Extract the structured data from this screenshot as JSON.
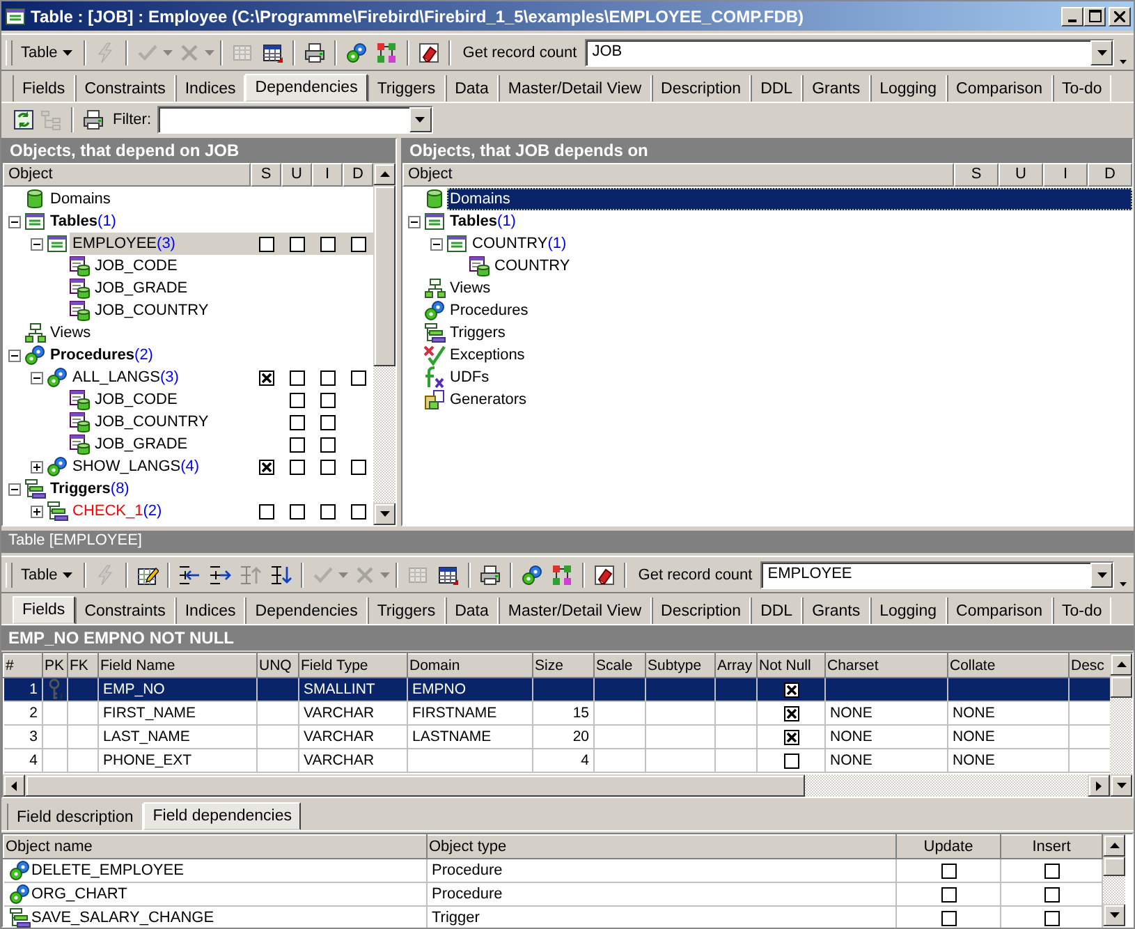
{
  "window": {
    "title": "Table : [JOB] : Employee (C:\\Programme\\Firebird\\Firebird_1_5\\examples\\EMPLOYEE_COMP.FDB)"
  },
  "toolbar": {
    "menu": "Table",
    "items": [
      {
        "kind": "lightning",
        "disabled": true
      },
      {
        "kind": "check",
        "disabled": true
      },
      {
        "kind": "cross",
        "disabled": true
      },
      {
        "kind": "grid",
        "disabled": true
      },
      {
        "kind": "calendar",
        "disabled": false
      },
      {
        "kind": "printer",
        "disabled": false
      },
      {
        "kind": "gears",
        "disabled": false
      },
      {
        "kind": "diagram",
        "disabled": false
      },
      {
        "kind": "eraser",
        "disabled": false
      }
    ],
    "button": "Get record count",
    "combo": "JOB"
  },
  "tabs": [
    {
      "label": "Fields",
      "selected": false
    },
    {
      "label": "Constraints",
      "selected": false
    },
    {
      "label": "Indices",
      "selected": false
    },
    {
      "label": "Dependencies",
      "selected": true
    },
    {
      "label": "Triggers",
      "selected": false
    },
    {
      "label": "Data",
      "selected": false
    },
    {
      "label": "Master/Detail View",
      "selected": false
    },
    {
      "label": "Description",
      "selected": false
    },
    {
      "label": "DDL",
      "selected": false
    },
    {
      "label": "Grants",
      "selected": false
    },
    {
      "label": "Logging",
      "selected": false
    },
    {
      "label": "Comparison",
      "selected": false
    },
    {
      "label": "To-do",
      "selected": false
    }
  ],
  "filter_bar": {
    "label": "Filter:"
  },
  "left_panel": {
    "title": "Objects, that depend on JOB",
    "columns": [
      "Object",
      "S",
      "U",
      "I",
      "D"
    ],
    "items": [
      {
        "label": "Domains",
        "kind": "domain"
      },
      {
        "label": "Tables",
        "count": "(1)",
        "bold": true,
        "kind": "table",
        "expanded": true,
        "children": [
          {
            "label": "EMPLOYEE",
            "count": "(3)",
            "kind": "table",
            "expanded": true,
            "selected": true,
            "s": false,
            "u": false,
            "i": false,
            "d": false,
            "children": [
              {
                "label": "JOB_CODE",
                "kind": "field"
              },
              {
                "label": "JOB_GRADE",
                "kind": "field"
              },
              {
                "label": "JOB_COUNTRY",
                "kind": "field"
              }
            ]
          }
        ]
      },
      {
        "label": "Views",
        "kind": "view"
      },
      {
        "label": "Procedures",
        "count": "(2)",
        "bold": true,
        "kind": "procedure",
        "expanded": true,
        "children": [
          {
            "label": "ALL_LANGS",
            "count": "(3)",
            "kind": "procedure",
            "expanded": true,
            "s": true,
            "u": false,
            "i": false,
            "d": false,
            "children": [
              {
                "label": "JOB_CODE",
                "kind": "field",
                "u": false,
                "i": false
              },
              {
                "label": "JOB_COUNTRY",
                "kind": "field",
                "u": false,
                "i": false
              },
              {
                "label": "JOB_GRADE",
                "kind": "field",
                "u": false,
                "i": false
              }
            ]
          },
          {
            "label": "SHOW_LANGS",
            "count": "(4)",
            "kind": "procedure",
            "expanded": false,
            "s": true,
            "u": false,
            "i": false,
            "d": false
          }
        ]
      },
      {
        "label": "Triggers",
        "count": "(8)",
        "bold": true,
        "kind": "trigger",
        "expanded": true,
        "children": [
          {
            "label": "CHECK_1",
            "count": "(2)",
            "kind": "trigger",
            "color": "#ff0000",
            "expanded": false,
            "s": false,
            "u": false,
            "i": false,
            "d": false
          }
        ]
      }
    ]
  },
  "right_panel": {
    "title": "Objects, that JOB depends on",
    "columns": [
      "Object",
      "S",
      "U",
      "I",
      "D"
    ],
    "items": [
      {
        "label": "Domains",
        "kind": "domain",
        "selected": true
      },
      {
        "label": "Tables",
        "count": "(1)",
        "bold": true,
        "kind": "table",
        "expanded": true,
        "children": [
          {
            "label": "COUNTRY",
            "count": "(1)",
            "kind": "table",
            "expanded": true,
            "children": [
              {
                "label": "COUNTRY",
                "kind": "field"
              }
            ]
          }
        ]
      },
      {
        "label": "Views",
        "kind": "view"
      },
      {
        "label": "Procedures",
        "kind": "procedure"
      },
      {
        "label": "Triggers",
        "kind": "trigger"
      },
      {
        "label": "Exceptions",
        "kind": "exception"
      },
      {
        "label": "UDFs",
        "kind": "udf"
      },
      {
        "label": "Generators",
        "kind": "generator"
      }
    ]
  },
  "sub_window": {
    "title": "Table [EMPLOYEE]",
    "toolbar": {
      "menu": "Table",
      "items": [
        {
          "kind": "lightning",
          "disabled": true
        },
        {
          "kind": "edit",
          "disabled": false
        },
        {
          "kind": "outdent",
          "disabled": false
        },
        {
          "kind": "indent",
          "disabled": false
        },
        {
          "kind": "up",
          "disabled": true
        },
        {
          "kind": "down",
          "disabled": false
        },
        {
          "kind": "check",
          "disabled": true
        },
        {
          "kind": "cross",
          "disabled": true
        },
        {
          "kind": "grid",
          "disabled": true
        },
        {
          "kind": "calendar",
          "disabled": false
        },
        {
          "kind": "printer",
          "disabled": false
        },
        {
          "kind": "gears",
          "disabled": false
        },
        {
          "kind": "diagram",
          "disabled": false
        },
        {
          "kind": "eraser",
          "disabled": false
        }
      ],
      "button": "Get record count",
      "combo": "EMPLOYEE"
    },
    "tabs": [
      {
        "label": "Fields",
        "selected": true
      },
      {
        "label": "Constraints",
        "selected": false
      },
      {
        "label": "Indices",
        "selected": false
      },
      {
        "label": "Dependencies",
        "selected": false
      },
      {
        "label": "Triggers",
        "selected": false
      },
      {
        "label": "Data",
        "selected": false
      },
      {
        "label": "Master/Detail View",
        "selected": false
      },
      {
        "label": "Description",
        "selected": false
      },
      {
        "label": "DDL",
        "selected": false
      },
      {
        "label": "Grants",
        "selected": false
      },
      {
        "label": "Logging",
        "selected": false
      },
      {
        "label": "Comparison",
        "selected": false
      },
      {
        "label": "To-do",
        "selected": false
      }
    ],
    "info_bar": "EMP_NO EMPNO NOT NULL",
    "fields_table": {
      "columns": [
        "#",
        "PK",
        "FK",
        "Field Name",
        "UNQ",
        "Field Type",
        "Domain",
        "Size",
        "Scale",
        "Subtype",
        "Array",
        "Not Null",
        "Charset",
        "Collate",
        "Desc"
      ],
      "rows": [
        {
          "num": "1",
          "pk": true,
          "field_name": "EMP_NO",
          "field_type": "SMALLINT",
          "domain": "EMPNO",
          "not_null": true,
          "selected": true
        },
        {
          "num": "2",
          "pk": false,
          "field_name": "FIRST_NAME",
          "field_type": "VARCHAR",
          "domain": "FIRSTNAME",
          "size": "15",
          "not_null": true,
          "charset": "NONE",
          "collate": "NONE",
          "selected": false
        },
        {
          "num": "3",
          "pk": false,
          "field_name": "LAST_NAME",
          "field_type": "VARCHAR",
          "domain": "LASTNAME",
          "size": "20",
          "not_null": true,
          "charset": "NONE",
          "collate": "NONE",
          "selected": false
        },
        {
          "num": "4",
          "pk": false,
          "field_name": "PHONE_EXT",
          "field_type": "VARCHAR",
          "size": "4",
          "not_null": false,
          "charset": "NONE",
          "collate": "NONE",
          "selected": false
        }
      ]
    },
    "bottom_tabs": [
      {
        "label": "Field description",
        "selected": false
      },
      {
        "label": "Field dependencies",
        "selected": true
      }
    ],
    "dependencies_table": {
      "columns": [
        "Object name",
        "Object type",
        "Update",
        "Insert"
      ],
      "rows": [
        {
          "kind": "procedure",
          "name": "DELETE_EMPLOYEE",
          "type": "Procedure",
          "update": false,
          "insert": false
        },
        {
          "kind": "procedure",
          "name": "ORG_CHART",
          "type": "Procedure",
          "update": false,
          "insert": false
        },
        {
          "kind": "trigger",
          "name": "SAVE_SALARY_CHANGE",
          "type": "Trigger",
          "update": false,
          "insert": false
        }
      ]
    }
  }
}
